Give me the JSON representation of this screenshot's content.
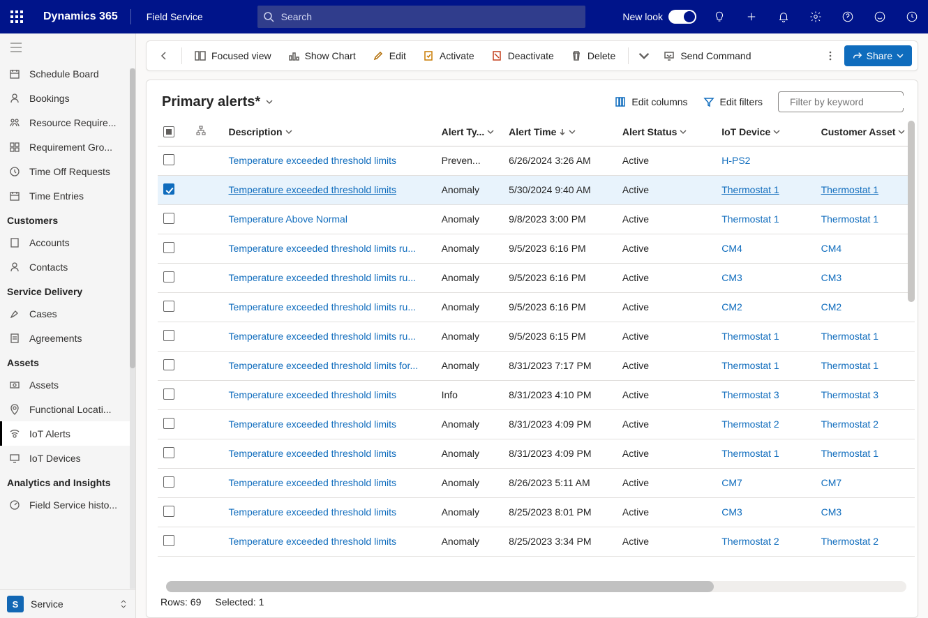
{
  "top": {
    "brand": "Dynamics 365",
    "module": "Field Service",
    "search_placeholder": "Search",
    "newlook": "New look"
  },
  "sidebar": {
    "groups": [
      {
        "items": [
          {
            "label": "Schedule Board",
            "icon": "calendar"
          },
          {
            "label": "Bookings",
            "icon": "person"
          },
          {
            "label": "Resource Require...",
            "icon": "people"
          },
          {
            "label": "Requirement Gro...",
            "icon": "grid"
          },
          {
            "label": "Time Off Requests",
            "icon": "clock"
          },
          {
            "label": "Time Entries",
            "icon": "calendar"
          }
        ]
      },
      {
        "title": "Customers",
        "items": [
          {
            "label": "Accounts",
            "icon": "building"
          },
          {
            "label": "Contacts",
            "icon": "person"
          }
        ]
      },
      {
        "title": "Service Delivery",
        "items": [
          {
            "label": "Cases",
            "icon": "case"
          },
          {
            "label": "Agreements",
            "icon": "doc"
          }
        ]
      },
      {
        "title": "Assets",
        "items": [
          {
            "label": "Assets",
            "icon": "asset"
          },
          {
            "label": "Functional Locati...",
            "icon": "pin"
          },
          {
            "label": "IoT Alerts",
            "icon": "iot",
            "active": true
          },
          {
            "label": "IoT Devices",
            "icon": "device"
          }
        ]
      },
      {
        "title": "Analytics and Insights",
        "items": [
          {
            "label": "Field Service histo...",
            "icon": "gauge"
          }
        ]
      }
    ],
    "area": {
      "chip": "S",
      "label": "Service"
    }
  },
  "toolbar": {
    "focused": "Focused view",
    "showchart": "Show Chart",
    "edit": "Edit",
    "activate": "Activate",
    "deactivate": "Deactivate",
    "delete": "Delete",
    "sendcmd": "Send Command",
    "share": "Share"
  },
  "view": {
    "name": "Primary alerts*",
    "editcols": "Edit columns",
    "editfilters": "Edit filters",
    "filter_placeholder": "Filter by keyword"
  },
  "columns": {
    "description": "Description",
    "alerttype": "Alert Ty...",
    "alerttime": "Alert Time",
    "alertstatus": "Alert Status",
    "iotdevice": "IoT Device",
    "customerasset": "Customer Asset"
  },
  "rows": [
    {
      "desc": "Temperature exceeded threshold limits",
      "type": "Preven...",
      "time": "6/26/2024 3:26 AM",
      "status": "Active",
      "device": "H-PS2",
      "asset": ""
    },
    {
      "desc": "Temperature exceeded threshold limits",
      "type": "Anomaly",
      "time": "5/30/2024 9:40 AM",
      "status": "Active",
      "device": "Thermostat 1",
      "asset": "Thermostat 1",
      "selected": true
    },
    {
      "desc": "Temperature Above Normal",
      "type": "Anomaly",
      "time": "9/8/2023 3:00 PM",
      "status": "Active",
      "device": "Thermostat 1",
      "asset": "Thermostat 1"
    },
    {
      "desc": "Temperature exceeded threshold limits ru...",
      "type": "Anomaly",
      "time": "9/5/2023 6:16 PM",
      "status": "Active",
      "device": "CM4",
      "asset": "CM4"
    },
    {
      "desc": "Temperature exceeded threshold limits ru...",
      "type": "Anomaly",
      "time": "9/5/2023 6:16 PM",
      "status": "Active",
      "device": "CM3",
      "asset": "CM3"
    },
    {
      "desc": "Temperature exceeded threshold limits ru...",
      "type": "Anomaly",
      "time": "9/5/2023 6:16 PM",
      "status": "Active",
      "device": "CM2",
      "asset": "CM2"
    },
    {
      "desc": "Temperature exceeded threshold limits ru...",
      "type": "Anomaly",
      "time": "9/5/2023 6:15 PM",
      "status": "Active",
      "device": "Thermostat 1",
      "asset": "Thermostat 1"
    },
    {
      "desc": "Temperature exceeded threshold limits for...",
      "type": "Anomaly",
      "time": "8/31/2023 7:17 PM",
      "status": "Active",
      "device": "Thermostat 1",
      "asset": "Thermostat 1"
    },
    {
      "desc": "Temperature exceeded threshold limits",
      "type": "Info",
      "time": "8/31/2023 4:10 PM",
      "status": "Active",
      "device": "Thermostat 3",
      "asset": "Thermostat 3"
    },
    {
      "desc": "Temperature exceeded threshold limits",
      "type": "Anomaly",
      "time": "8/31/2023 4:09 PM",
      "status": "Active",
      "device": "Thermostat 2",
      "asset": "Thermostat 2"
    },
    {
      "desc": "Temperature exceeded threshold limits",
      "type": "Anomaly",
      "time": "8/31/2023 4:09 PM",
      "status": "Active",
      "device": "Thermostat 1",
      "asset": "Thermostat 1"
    },
    {
      "desc": "Temperature exceeded threshold limits",
      "type": "Anomaly",
      "time": "8/26/2023 5:11 AM",
      "status": "Active",
      "device": "CM7",
      "asset": "CM7"
    },
    {
      "desc": "Temperature exceeded threshold limits",
      "type": "Anomaly",
      "time": "8/25/2023 8:01 PM",
      "status": "Active",
      "device": "CM3",
      "asset": "CM3"
    },
    {
      "desc": "Temperature exceeded threshold limits",
      "type": "Anomaly",
      "time": "8/25/2023 3:34 PM",
      "status": "Active",
      "device": "Thermostat 2",
      "asset": "Thermostat 2"
    }
  ],
  "footer": {
    "rows": "Rows: 69",
    "selected": "Selected: 1"
  }
}
